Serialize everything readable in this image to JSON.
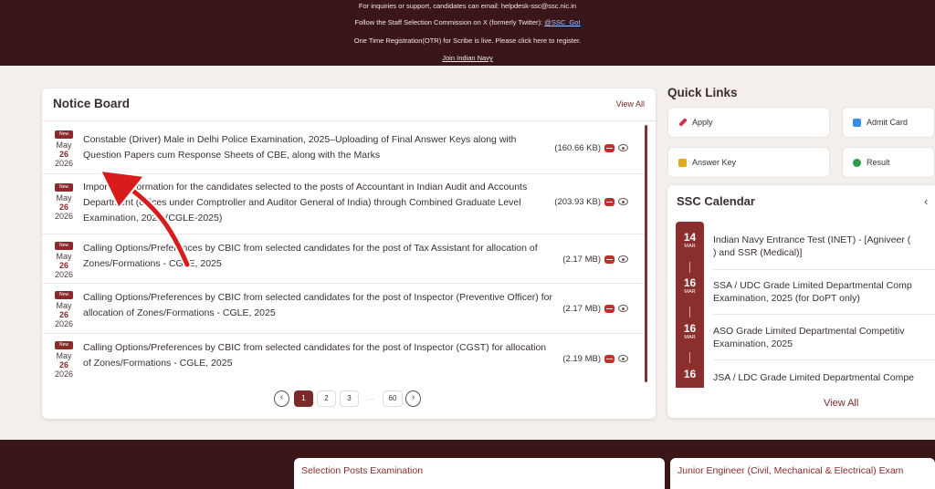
{
  "banner": {
    "line1": "For inquiries or support, candidates can email: helpdesk-ssc@ssc.nic.in",
    "line2_prefix": "Follow the Staff Selection Commission on X (formerly Twitter): ",
    "line2_link": "@SSC_GoI",
    "line3": "One Time Registration(OTR) for Scribe is live. Please click here to register.",
    "line4": "Join Indian Navy"
  },
  "notice_board": {
    "title": "Notice Board",
    "view_all": "View All",
    "badge": "New",
    "items": [
      {
        "month": "May",
        "day": "26",
        "year": "2026",
        "text": "Constable (Driver) Male in Delhi Police Examination, 2025–Uploading of Final Answer Keys along with Question Papers cum Response Sheets of CBE, along with the Marks",
        "size": "(160.66 KB)"
      },
      {
        "month": "May",
        "day": "26",
        "year": "2026",
        "text": "Important information for the candidates selected to the posts of Accountant in Indian Audit and Accounts Department (offices under Comptroller and Auditor General of India) through Combined Graduate Level Examination, 2025 (CGLE-2025)",
        "size": "(203.93 KB)"
      },
      {
        "month": "May",
        "day": "26",
        "year": "2026",
        "text": "Calling Options/Preferences by CBIC from selected candidates for the post of Tax Assistant for allocation of Zones/Formations - CGLE, 2025",
        "size": "(2.17 MB)"
      },
      {
        "month": "May",
        "day": "26",
        "year": "2026",
        "text": "Calling Options/Preferences by CBIC from selected candidates for the post of Inspector (Preventive Officer) for allocation of Zones/Formations - CGLE, 2025",
        "size": "(2.17 MB)"
      },
      {
        "month": "May",
        "day": "26",
        "year": "2026",
        "text": "Calling Options/Preferences by CBIC from selected candidates for the post of Inspector (CGST) for allocation of Zones/Formations - CGLE, 2025",
        "size": "(2.19 MB)"
      }
    ],
    "pagination": {
      "prev": "‹",
      "pages": [
        "1",
        "2",
        "3"
      ],
      "dots": "...",
      "last": "60",
      "next": "›",
      "current": "1"
    }
  },
  "quick_links": {
    "title": "Quick Links",
    "items": [
      {
        "label": "Apply",
        "icon": "pencil-icon",
        "color": "#d2354a"
      },
      {
        "label": "Admit Card",
        "icon": "id-card-icon",
        "color": "#3a8ee0"
      },
      {
        "label": "Answer Key",
        "icon": "key-icon",
        "color": "#e0a820"
      },
      {
        "label": "Result",
        "icon": "result-icon",
        "color": "#2f9a4a"
      }
    ]
  },
  "calendar": {
    "title": "SSC Calendar",
    "prev": "‹",
    "view_all": "View All",
    "events": [
      {
        "day": "14",
        "month": "MAR",
        "line1": "Indian Navy Entrance Test (INET) - [Agniveer (",
        "line2": ") and SSR (Medical)]"
      },
      {
        "day": "16",
        "month": "MAR",
        "line1": "SSA / UDC Grade Limited Departmental Comp",
        "line2": "Examination, 2025 (for DoPT only)"
      },
      {
        "day": "16",
        "month": "MAR",
        "line1": "ASO Grade Limited Departmental Competitiv",
        "line2": "Examination, 2025"
      },
      {
        "day": "16",
        "month": "",
        "line1": "JSA / LDC Grade Limited Departmental Compe",
        "line2": ""
      }
    ]
  },
  "bottom_cards": {
    "left_title": "Selection Posts Examination",
    "right_title": "Junior Engineer (Civil, Mechanical & Electrical) Exam"
  }
}
